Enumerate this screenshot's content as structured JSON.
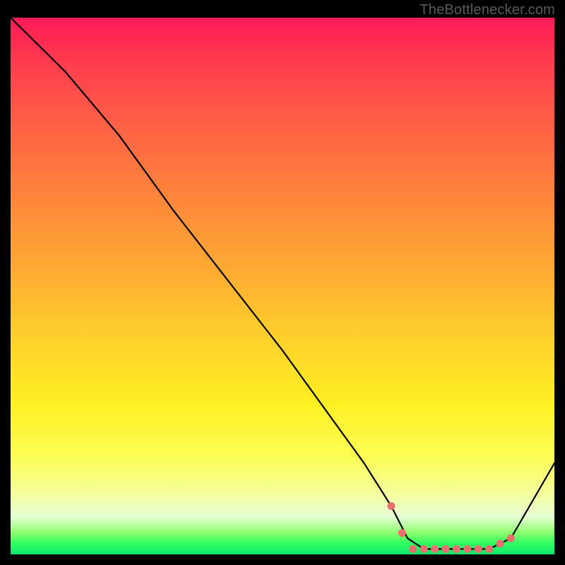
{
  "attribution": "TheBottlenecker.com",
  "chart_data": {
    "type": "line",
    "title": "",
    "xlabel": "",
    "ylabel": "",
    "xlim": [
      0,
      100
    ],
    "ylim": [
      0,
      100
    ],
    "series": [
      {
        "name": "curve",
        "x": [
          0,
          4,
          10,
          20,
          30,
          40,
          50,
          60,
          65,
          70,
          73,
          76,
          80,
          84,
          88,
          92,
          100
        ],
        "y": [
          100,
          96,
          90,
          78,
          64,
          51,
          38,
          24,
          17,
          9,
          3,
          1,
          1,
          1,
          1,
          3,
          17
        ]
      },
      {
        "name": "markers",
        "x": [
          70,
          72,
          74,
          76,
          78,
          80,
          82,
          84,
          86,
          88,
          90,
          92
        ],
        "y": [
          9,
          4,
          1,
          1,
          1,
          1,
          1,
          1,
          1,
          1,
          2,
          3
        ]
      }
    ],
    "marker_color": "#ec6f6f",
    "curve_color": "#000000",
    "background": "rainbow-vertical"
  }
}
